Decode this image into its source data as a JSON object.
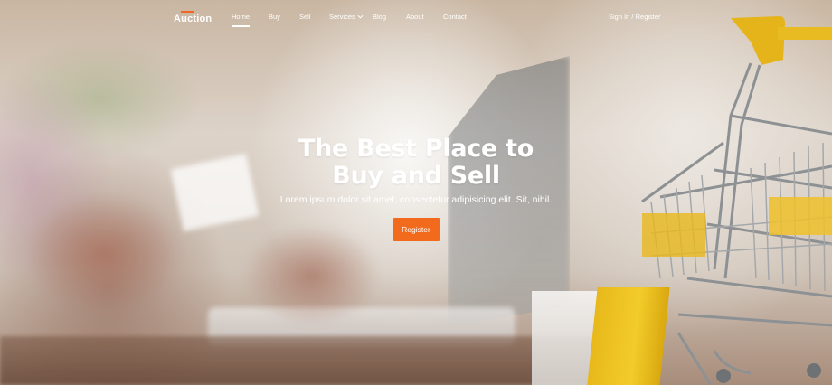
{
  "brand": {
    "name": "Auction",
    "accent": "#f26522"
  },
  "nav": {
    "items": [
      {
        "label": "Home",
        "active": true
      },
      {
        "label": "Buy"
      },
      {
        "label": "Sell"
      },
      {
        "label": "Services",
        "has_dropdown": true
      },
      {
        "label": "Blog"
      },
      {
        "label": "About"
      },
      {
        "label": "Contact"
      }
    ],
    "auth_label": "Sign In / Register",
    "dropdown_icon": "chevron-down-icon"
  },
  "hero": {
    "title_line1": "The Best Place to",
    "title_line2": "Buy and Sell",
    "subtitle": "Lorem ipsum dolor sit amet, consectetur adipisicing elit. Sit, nihil.",
    "cta_label": "Register",
    "cta_color": "#f26b1d"
  }
}
